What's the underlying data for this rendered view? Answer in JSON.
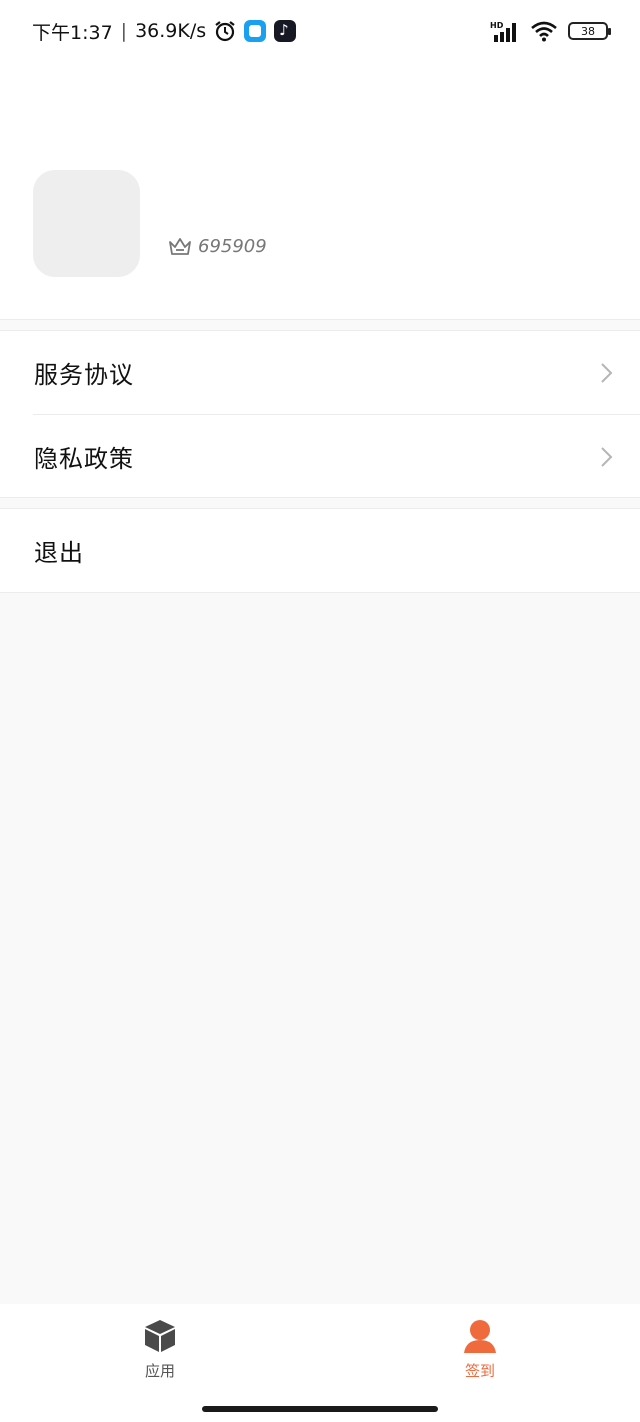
{
  "status_bar": {
    "time": "下午1:37",
    "net_speed": "36.9K/s",
    "network": "HD",
    "battery": "38",
    "icons": [
      "alarm-icon",
      "message-app-icon",
      "tiktok-app-icon",
      "signal-icon",
      "wifi-icon",
      "battery-icon"
    ]
  },
  "profile": {
    "user_id": "695909",
    "id_icon": "crown-icon"
  },
  "menu": {
    "items": [
      {
        "label": "服务协议"
      },
      {
        "label": "隐私政策"
      }
    ],
    "logout_label": "退出"
  },
  "tabbar": {
    "tabs": [
      {
        "label": "应用",
        "icon": "box-icon",
        "active": false
      },
      {
        "label": "签到",
        "icon": "person-icon",
        "active": true
      }
    ]
  },
  "colors": {
    "accent": "#ef6a3d",
    "background": "#f9f9f9",
    "surface": "#ffffff"
  }
}
